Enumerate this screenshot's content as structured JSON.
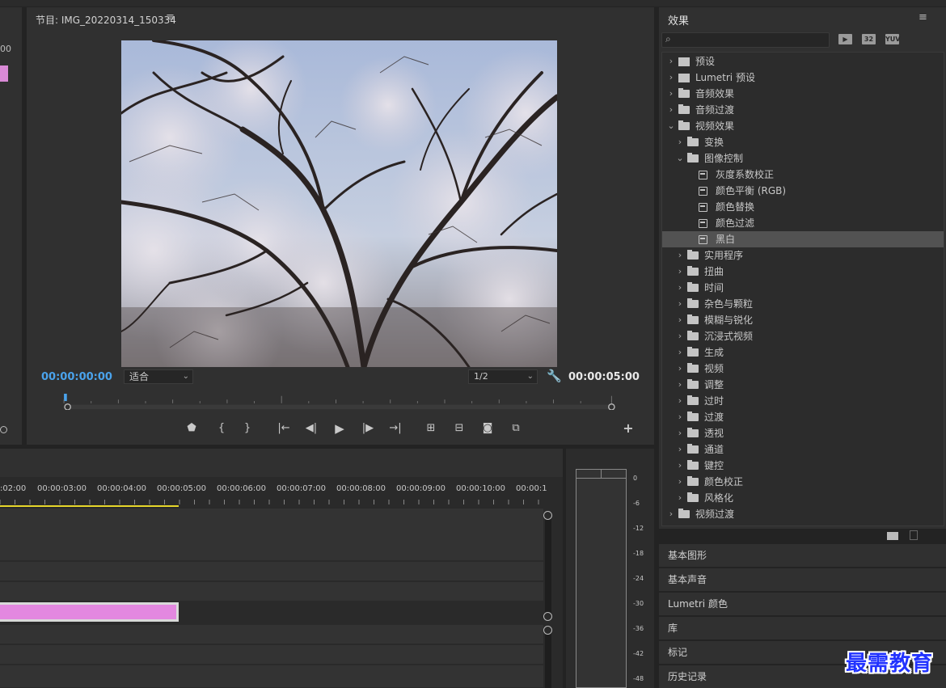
{
  "monitor": {
    "title": "节目: IMG_20220314_150334",
    "menu_icon": "hamburger-icon",
    "timecode_current": "00:00:00:00",
    "timecode_duration": "00:00:05:00",
    "fit_label": "适合",
    "resolution_label": "1/2",
    "settings_icon": "wrench-icon",
    "video_alt": "cherry blossom branches against sky"
  },
  "left_panel": {
    "partial_value": "00"
  },
  "effects": {
    "title": "效果",
    "menu_icon": "hamburger-icon",
    "search_icon": "search-icon",
    "search_value": "",
    "filter_buttons": [
      "accelerated-icon",
      "32",
      "YUV"
    ],
    "tree": [
      {
        "label": "预设",
        "level": 0,
        "icon": "preset",
        "expanded": false
      },
      {
        "label": "Lumetri 预设",
        "level": 0,
        "icon": "preset",
        "expanded": false
      },
      {
        "label": "音频效果",
        "level": 0,
        "icon": "folder",
        "expanded": false
      },
      {
        "label": "音频过渡",
        "level": 0,
        "icon": "folder",
        "expanded": false
      },
      {
        "label": "视频效果",
        "level": 0,
        "icon": "folder",
        "expanded": true
      },
      {
        "label": "变换",
        "level": 1,
        "icon": "folder",
        "expanded": false
      },
      {
        "label": "图像控制",
        "level": 1,
        "icon": "folder",
        "expanded": true
      },
      {
        "label": "灰度系数校正",
        "level": 2,
        "icon": "effect",
        "expanded": null
      },
      {
        "label": "颜色平衡 (RGB)",
        "level": 2,
        "icon": "effect",
        "expanded": null
      },
      {
        "label": "颜色替换",
        "level": 2,
        "icon": "effect",
        "expanded": null
      },
      {
        "label": "颜色过滤",
        "level": 2,
        "icon": "effect",
        "expanded": null
      },
      {
        "label": "黑白",
        "level": 2,
        "icon": "effect",
        "expanded": null,
        "selected": true
      },
      {
        "label": "实用程序",
        "level": 1,
        "icon": "folder",
        "expanded": false
      },
      {
        "label": "扭曲",
        "level": 1,
        "icon": "folder",
        "expanded": false
      },
      {
        "label": "时间",
        "level": 1,
        "icon": "folder",
        "expanded": false
      },
      {
        "label": "杂色与颗粒",
        "level": 1,
        "icon": "folder",
        "expanded": false
      },
      {
        "label": "模糊与锐化",
        "level": 1,
        "icon": "folder",
        "expanded": false
      },
      {
        "label": "沉浸式视频",
        "level": 1,
        "icon": "folder",
        "expanded": false
      },
      {
        "label": "生成",
        "level": 1,
        "icon": "folder",
        "expanded": false
      },
      {
        "label": "视频",
        "level": 1,
        "icon": "folder",
        "expanded": false
      },
      {
        "label": "调整",
        "level": 1,
        "icon": "folder",
        "expanded": false
      },
      {
        "label": "过时",
        "level": 1,
        "icon": "folder",
        "expanded": false
      },
      {
        "label": "过渡",
        "level": 1,
        "icon": "folder",
        "expanded": false
      },
      {
        "label": "透视",
        "level": 1,
        "icon": "folder",
        "expanded": false
      },
      {
        "label": "通道",
        "level": 1,
        "icon": "folder",
        "expanded": false
      },
      {
        "label": "键控",
        "level": 1,
        "icon": "folder",
        "expanded": false
      },
      {
        "label": "颜色校正",
        "level": 1,
        "icon": "folder",
        "expanded": false
      },
      {
        "label": "风格化",
        "level": 1,
        "icon": "folder",
        "expanded": false
      },
      {
        "label": "视频过渡",
        "level": 0,
        "icon": "folder",
        "expanded": false
      }
    ],
    "bottom_icons": [
      "new-folder-icon",
      "trash-icon"
    ]
  },
  "collapsed_panels": [
    "基本图形",
    "基本声音",
    "Lumetri 颜色",
    "库",
    "标记",
    "历史记录"
  ],
  "timeline": {
    "ruler_labels": [
      ":02:00",
      "00:00:03:00",
      "00:00:04:00",
      "00:00:05:00",
      "00:00:06:00",
      "00:00:07:00",
      "00:00:08:00",
      "00:00:09:00",
      "00:00:10:00",
      "00:00:1"
    ]
  },
  "meter": {
    "db_labels": [
      "0",
      "-6",
      "-12",
      "-18",
      "-24",
      "-30",
      "-36",
      "-42",
      "-48"
    ]
  },
  "watermark": "最需教育",
  "colors": {
    "accent_blue": "#4aa3ec",
    "clip_pink": "#e388e0",
    "playhead_yellow": "#e6d62a",
    "panel_bg": "#303030",
    "selection": "#525252"
  }
}
